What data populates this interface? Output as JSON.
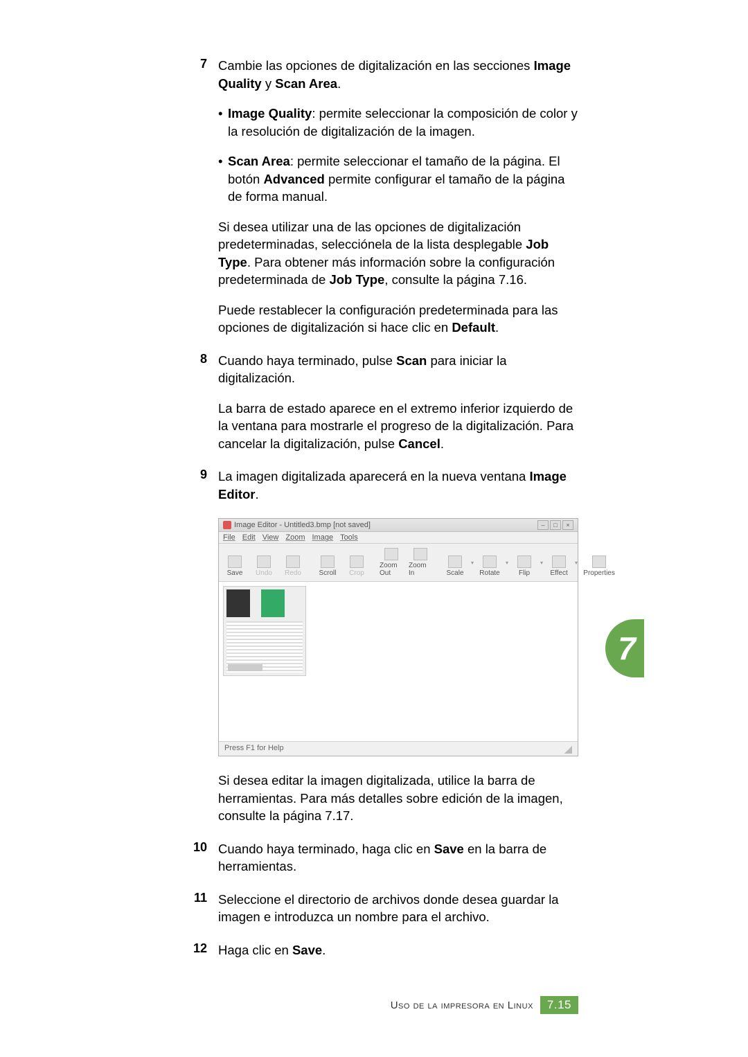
{
  "steps": {
    "s7": {
      "num": "7",
      "intro_a": "Cambie las opciones de digitalización en las secciones ",
      "intro_b1": "Image Quality",
      "intro_c": " y ",
      "intro_b2": "Scan Area",
      "intro_d": ".",
      "bullet1_b": "Image Quality",
      "bullet1_t": ": permite seleccionar la composición de color y la resolución de digitalización de la imagen.",
      "bullet2_b": "Scan Area",
      "bullet2_t1": ": permite seleccionar el tamaño de la página. El botón ",
      "bullet2_b2": "Advanced",
      "bullet2_t2": " permite configurar el tamaño de la página de forma manual.",
      "p1a": "Si desea utilizar una de las opciones de digitalización predeterminadas, selecciónela de la lista desplegable ",
      "p1b": "Job Type",
      "p1c": ". Para obtener más información sobre la configuración predeterminada de ",
      "p1d": "Job Type",
      "p1e": ", consulte la página 7.16.",
      "p2a": "Puede restablecer la configuración predeterminada para las opciones de digitalización si hace clic en ",
      "p2b": "Default",
      "p2c": "."
    },
    "s8": {
      "num": "8",
      "p1a": "Cuando haya terminado, pulse ",
      "p1b": "Scan",
      "p1c": " para iniciar la digitalización.",
      "p2a": "La barra de estado aparece en el extremo inferior izquierdo de la ventana para mostrarle el progreso de la digitalización. Para cancelar la digitalización, pulse ",
      "p2b": "Cancel",
      "p2c": "."
    },
    "s9": {
      "num": "9",
      "p1a": "La imagen digitalizada aparecerá en la nueva ventana ",
      "p1b": "Image Editor",
      "p1c": ".",
      "after_a": "Si desea editar la imagen digitalizada, utilice la barra de herramientas. Para más detalles sobre edición de la imagen, consulte la página 7.17."
    },
    "s10": {
      "num": "10",
      "a": "Cuando haya terminado, haga clic en ",
      "b": "Save",
      "c": " en la barra de herramientas."
    },
    "s11": {
      "num": "11",
      "a": "Seleccione el directorio de archivos donde desea guardar la imagen e introduzca un nombre para el archivo."
    },
    "s12": {
      "num": "12",
      "a": "Haga clic en ",
      "b": "Save",
      "c": "."
    }
  },
  "screenshot": {
    "title": "Image Editor - Untitled3.bmp [not saved]",
    "menus": {
      "file": "File",
      "edit": "Edit",
      "view": "View",
      "zoom": "Zoom",
      "image": "Image",
      "tools": "Tools"
    },
    "toolbar": {
      "save": "Save",
      "undo": "Undo",
      "redo": "Redo",
      "scroll": "Scroll",
      "crop": "Crop",
      "zoomout": "Zoom Out",
      "zoomin": "Zoom In",
      "scale": "Scale",
      "rotate": "Rotate",
      "flip": "Flip",
      "effect": "Effect",
      "properties": "Properties"
    },
    "status": "Press F1 for Help"
  },
  "sidetab": "7",
  "footer": {
    "label": "Uso de la impresora en Linux",
    "page": "7.15"
  }
}
